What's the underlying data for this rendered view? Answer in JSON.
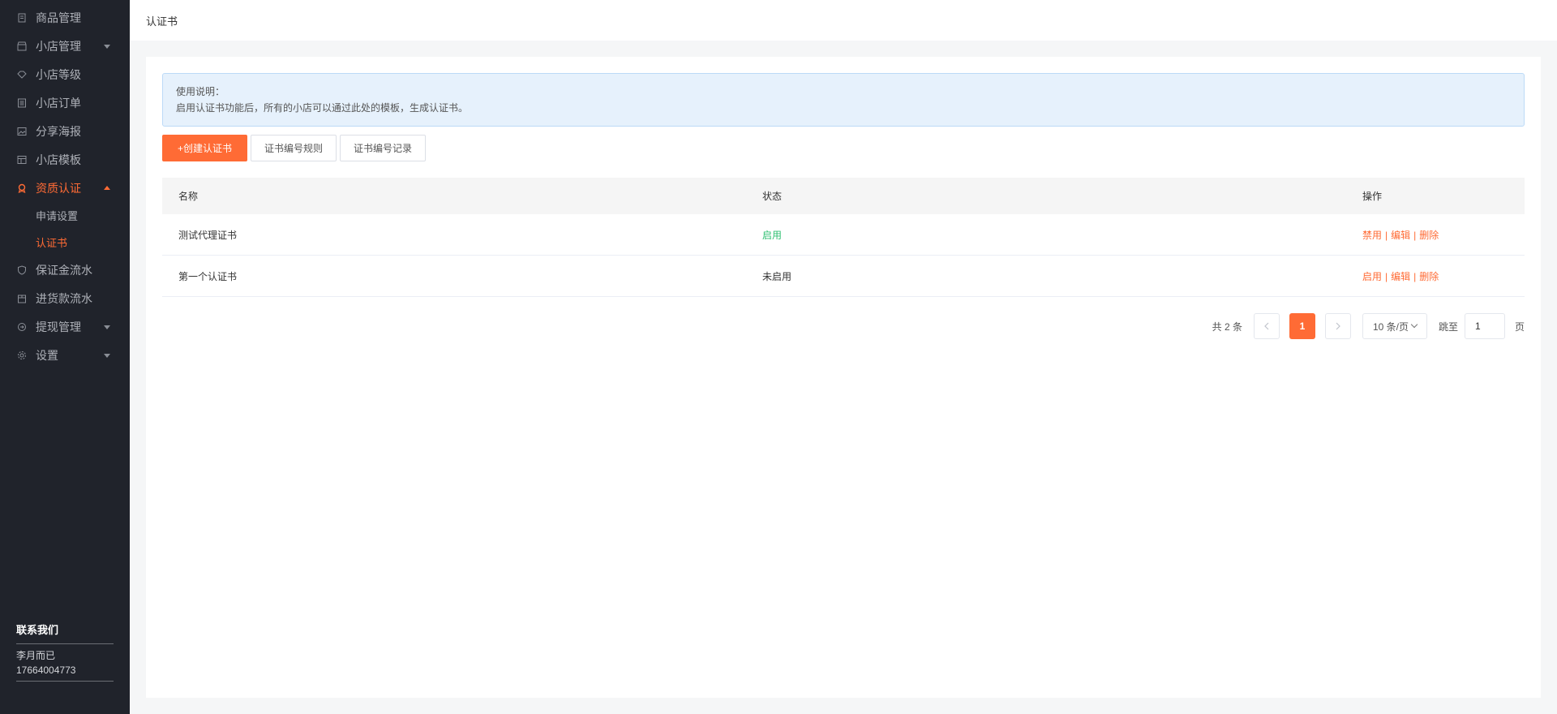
{
  "sidebar": {
    "items": [
      {
        "label": "商品管理",
        "icon": "doc-icon"
      },
      {
        "label": "小店管理",
        "icon": "shop-icon",
        "caret": true
      },
      {
        "label": "小店等级",
        "icon": "diamond-icon"
      },
      {
        "label": "小店订单",
        "icon": "list-icon"
      },
      {
        "label": "分享海报",
        "icon": "image-icon"
      },
      {
        "label": "小店模板",
        "icon": "template-icon"
      },
      {
        "label": "资质认证",
        "icon": "badge-icon",
        "caret": true,
        "active": true
      },
      {
        "label": "保证金流水",
        "icon": "shield-icon"
      },
      {
        "label": "进货款流水",
        "icon": "box-icon"
      },
      {
        "label": "提现管理",
        "icon": "withdraw-icon",
        "caret": true
      },
      {
        "label": "设置",
        "icon": "gear-icon",
        "caret": true
      }
    ],
    "submenu": [
      {
        "label": "申请设置"
      },
      {
        "label": "认证书",
        "active": true
      }
    ],
    "contact": {
      "title": "联系我们",
      "name": "李月而已",
      "phone": "17664004773"
    }
  },
  "header": {
    "title": "认证书"
  },
  "notice": {
    "title": "使用说明：",
    "text": "启用认证书功能后，所有的小店可以通过此处的模板，生成认证书。"
  },
  "toolbar": {
    "create_label": "+创建认证书",
    "rule_label": "证书编号规则",
    "record_label": "证书编号记录"
  },
  "table": {
    "headers": {
      "name": "名称",
      "status": "状态",
      "ops": "操作"
    },
    "rows": [
      {
        "name": "测试代理证书",
        "status": "启用",
        "toggle": "禁用",
        "edit": "编辑",
        "delete": "删除"
      },
      {
        "name": "第一个认证书",
        "status": "未启用",
        "toggle": "启用",
        "edit": "编辑",
        "delete": "删除"
      }
    ],
    "separator": "|"
  },
  "pagination": {
    "total": "共 2 条",
    "current": "1",
    "page_size": "10 条/页",
    "jump_label": "跳至",
    "jump_value": "1",
    "page_suffix": "页"
  },
  "colors": {
    "accent": "#ff6b35",
    "sidebar_bg": "#20232b",
    "status_on": "#2fbf71",
    "notice_bg": "#e6f1fc"
  }
}
